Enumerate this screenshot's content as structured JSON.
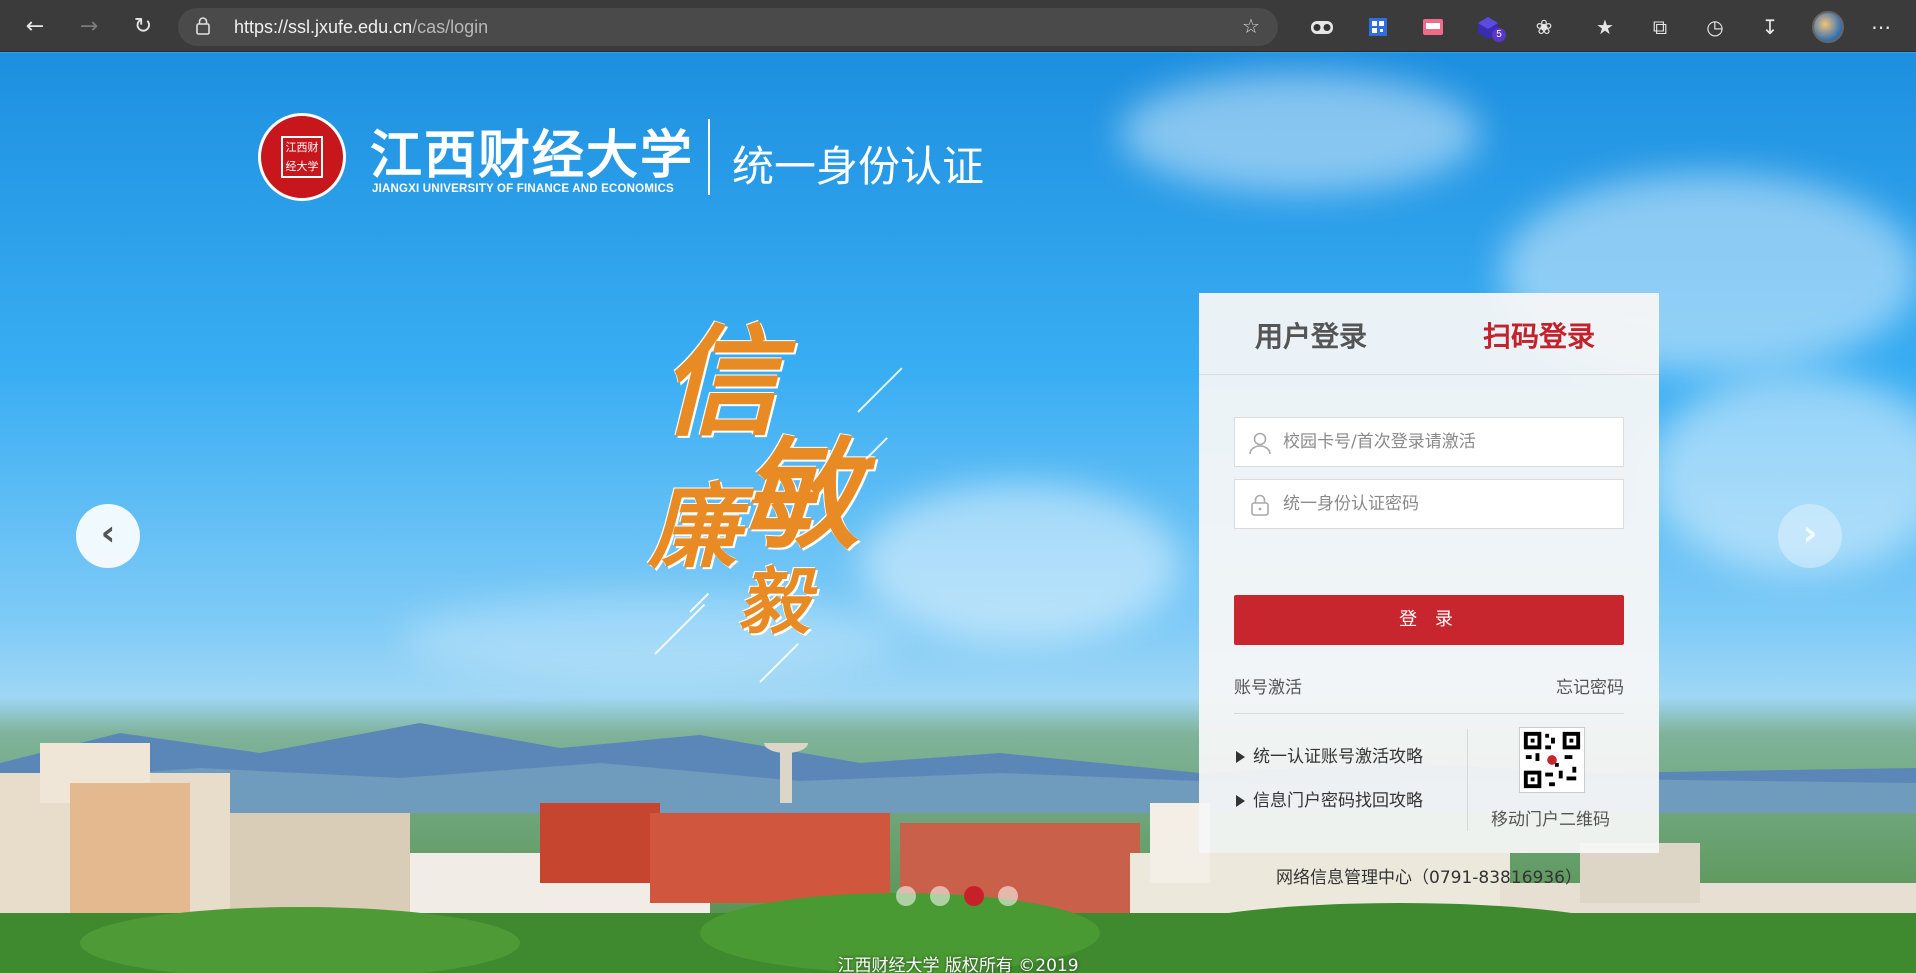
{
  "browser": {
    "url_host": "https://ssl.jxufe.edu.cn",
    "url_path": "/cas/login",
    "extension_badge": "5",
    "icons": [
      "back-icon",
      "forward-icon",
      "refresh-icon",
      "lock-icon",
      "favorite-add-icon",
      "extension-icon",
      "favorites-icon",
      "collections-icon",
      "history-icon",
      "download-icon",
      "more-icon"
    ]
  },
  "header": {
    "seal_text": "江西财经大学",
    "school_name": "江西财经大学",
    "school_name_en": "JIANGXI UNIVERSITY OF FINANCE AND ECONOMICS",
    "subtitle": "统一身份认证"
  },
  "slogan": {
    "char1": "信",
    "char2": "敏",
    "char3": "廉",
    "char4": "毅"
  },
  "carousel": {
    "slide_count": 4,
    "active_slide": 3
  },
  "login": {
    "tab_user": "用户登录",
    "tab_scan": "扫码登录",
    "username_placeholder": "校园卡号/首次登录请激活",
    "password_placeholder": "统一身份认证密码",
    "login_button": "登 录",
    "activate_link": "账号激活",
    "forgot_link": "忘记密码",
    "guide_activate": "统一认证账号激活攻略",
    "guide_password": "信息门户密码找回攻略",
    "qr_label": "移动门户二维码",
    "footer": "网络信息管理中心（0791-83816936）"
  },
  "copyright": "江西财经大学  版权所有  ©2019",
  "colors": {
    "brand_red": "#c8262e",
    "slogan_orange": "#e98b24",
    "chrome_bg": "#3b3b3b"
  }
}
